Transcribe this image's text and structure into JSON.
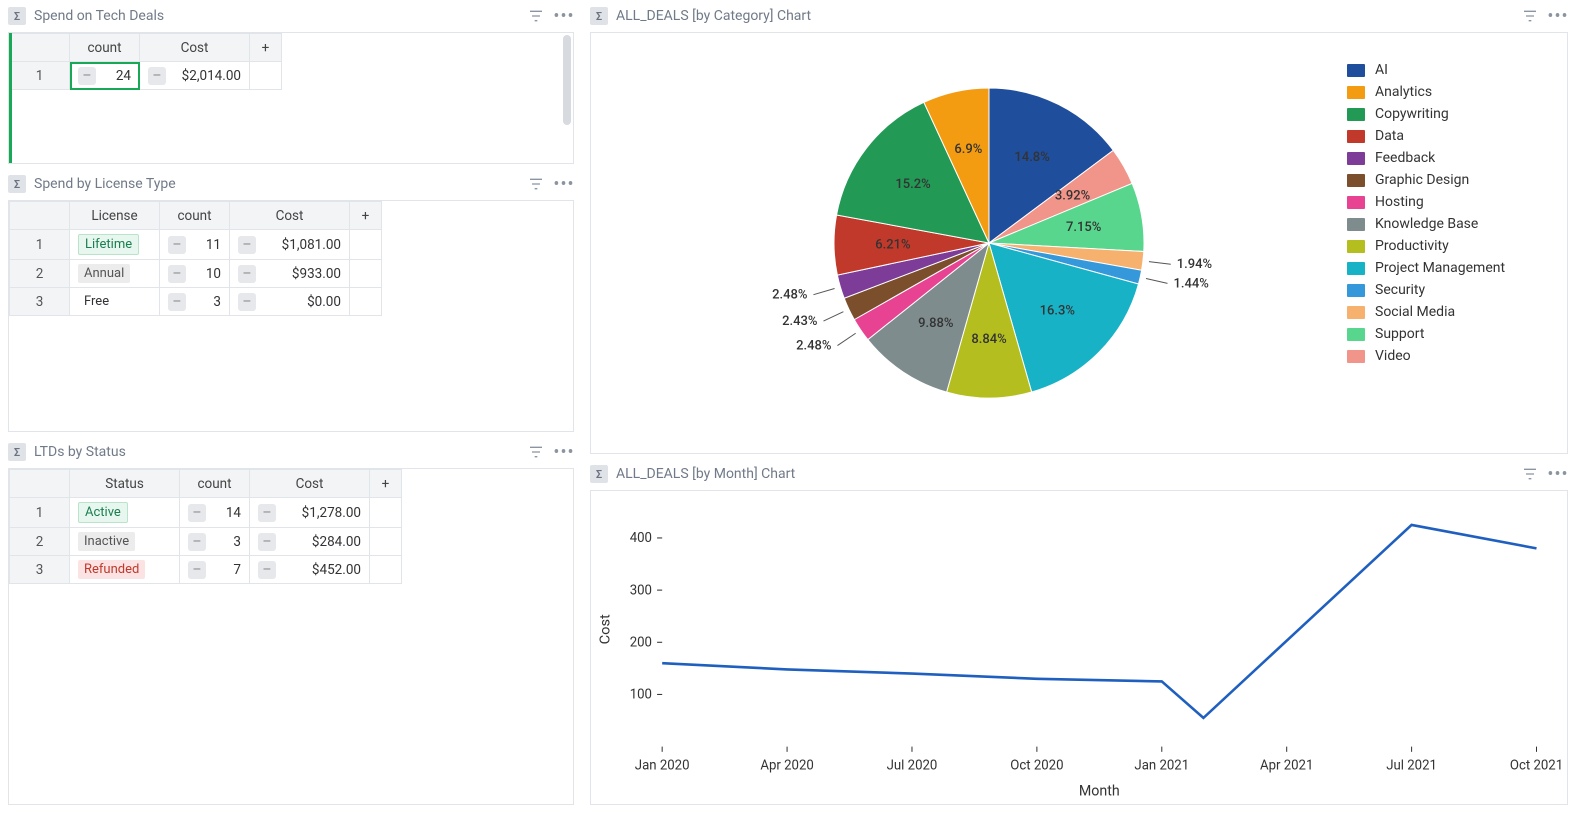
{
  "panels": {
    "tech_deals": {
      "title": "Spend on Tech Deals"
    },
    "license": {
      "title": "Spend by License Type"
    },
    "status": {
      "title": "LTDs by Status"
    },
    "by_category": {
      "title": "ALL_DEALS [by Category] Chart"
    },
    "by_month": {
      "title": "ALL_DEALS [by Month] Chart"
    }
  },
  "tbl_tech": {
    "cols": [
      "count",
      "Cost"
    ],
    "rows": [
      {
        "n": "1",
        "count": "24",
        "cost": "$2,014.00"
      }
    ]
  },
  "tbl_license": {
    "cols": [
      "License",
      "count",
      "Cost"
    ],
    "rows": [
      {
        "n": "1",
        "license": "Lifetime",
        "tagclass": "tag-lifetime",
        "count": "11",
        "cost": "$1,081.00"
      },
      {
        "n": "2",
        "license": "Annual",
        "tagclass": "tag-annual",
        "count": "10",
        "cost": "$933.00"
      },
      {
        "n": "3",
        "license": "Free",
        "tagclass": "tag-free",
        "count": "3",
        "cost": "$0.00"
      }
    ]
  },
  "tbl_status": {
    "cols": [
      "Status",
      "count",
      "Cost"
    ],
    "rows": [
      {
        "n": "1",
        "status": "Active",
        "tagclass": "tag-active",
        "count": "14",
        "cost": "$1,278.00"
      },
      {
        "n": "2",
        "status": "Inactive",
        "tagclass": "tag-inactive",
        "count": "3",
        "cost": "$284.00"
      },
      {
        "n": "3",
        "status": "Refunded",
        "tagclass": "tag-refunded",
        "count": "7",
        "cost": "$452.00"
      }
    ]
  },
  "add_label": "+",
  "chart_data": [
    {
      "id": "by_category",
      "type": "pie",
      "title": "ALL_DEALS [by Category] Chart",
      "series": [
        {
          "name": "AI",
          "value": 14.8,
          "color": "#1f4e9c",
          "label": "14.8%",
          "label_side": "in"
        },
        {
          "name": "Analytics",
          "value": 6.9,
          "color": "#f39c12",
          "label": "6.9%",
          "label_side": "in"
        },
        {
          "name": "Copywriting",
          "value": 15.2,
          "color": "#229954",
          "label": "15.2%",
          "label_side": "in"
        },
        {
          "name": "Data",
          "value": 6.21,
          "color": "#c0392b",
          "label": "6.21%",
          "label_side": "in"
        },
        {
          "name": "Feedback",
          "value": 2.48,
          "color": "#7d3c98",
          "label": "2.48%",
          "label_side": "out"
        },
        {
          "name": "Graphic Design",
          "value": 2.43,
          "color": "#7b4f2c",
          "label": "2.43%",
          "label_side": "out"
        },
        {
          "name": "Hosting",
          "value": 2.48,
          "color": "#e84393",
          "label": "2.48%",
          "label_side": "out"
        },
        {
          "name": "Knowledge Base",
          "value": 9.88,
          "color": "#7f8c8d",
          "label": "9.88%",
          "label_side": "in"
        },
        {
          "name": "Productivity",
          "value": 8.84,
          "color": "#b4bf1f",
          "label": "8.84%",
          "label_side": "in"
        },
        {
          "name": "Project Management",
          "value": 16.3,
          "color": "#17b2c6",
          "label": "16.3%",
          "label_side": "in"
        },
        {
          "name": "Security",
          "value": 1.44,
          "color": "#3498db",
          "label": "1.44%",
          "label_side": "out"
        },
        {
          "name": "Social Media",
          "value": 1.94,
          "color": "#f5b16d",
          "label": "1.94%",
          "label_side": "out"
        },
        {
          "name": "Support",
          "value": 7.15,
          "color": "#58d68d",
          "label": "7.15%",
          "label_side": "in"
        },
        {
          "name": "Video",
          "value": 3.92,
          "color": "#f1948a",
          "label": "3.92%",
          "label_side": "in"
        }
      ]
    },
    {
      "id": "by_month",
      "type": "line",
      "title": "ALL_DEALS [by Month] Chart",
      "xlabel": "Month",
      "ylabel": "Cost",
      "x": [
        "Jan 2020",
        "Apr 2020",
        "Jul 2020",
        "Oct 2020",
        "Jan 2021",
        "Apr 2021",
        "Jul 2021",
        "Oct 2021"
      ],
      "y_ticks": [
        100,
        200,
        300,
        400
      ],
      "ylim": [
        0,
        450
      ],
      "values": [
        {
          "x": "Jan 2020",
          "y": 160
        },
        {
          "x": "Apr 2020",
          "y": 148
        },
        {
          "x": "Jul 2020",
          "y": 140
        },
        {
          "x": "Oct 2020",
          "y": 130
        },
        {
          "x": "Jan 2021",
          "y": 125
        },
        {
          "x": "Feb 2021",
          "y": 55
        },
        {
          "x": "Jul 2021",
          "y": 425
        },
        {
          "x": "Oct 2021",
          "y": 380
        }
      ]
    }
  ]
}
